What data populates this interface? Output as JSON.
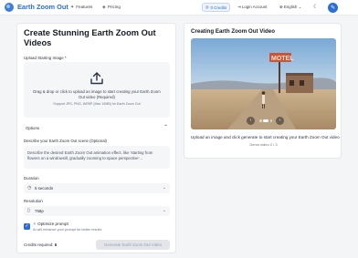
{
  "nav": {
    "brand": "Earth Zoom Out",
    "links": [
      {
        "label": "Features",
        "icon": "sparkle-icon"
      },
      {
        "label": "Pricing",
        "icon": "tag-icon"
      }
    ],
    "credits": "0 Credits",
    "login": "Login Account",
    "language": "English",
    "accent_color": "#2b6fd6"
  },
  "left": {
    "title": "Create Stunning Earth Zoom Out Videos",
    "upload_label": "Upload Starting Image *",
    "drop_text": "Drag & drop or click to upload an image to start creating your Earth Zoom Out video (Required)",
    "drop_sub": "Support JPG, PNG, WEBP (Max 10MB) for Earth Zoom Out",
    "options_label": "Options",
    "description_label": "Describe your Earth Zoom Out scene (Optional)",
    "description_placeholder": "Describe the desired Earth Zoom Out animation effect, like 'starting from flowers on a windowsill, gradually zooming to space perspective'...",
    "duration_label": "Duration",
    "duration_value": "6 seconds",
    "resolution_label": "Resolution",
    "resolution_value": "768p",
    "optimize_title": "Optimize prompt",
    "optimize_sub": "AI will enhance your prompt for better results",
    "optimize_checked": true,
    "credits_required_label": "Credits required:",
    "credits_required_value": "6",
    "generate_label": "Generate Earth Zoom Out Video"
  },
  "right": {
    "title": "Creating Earth Zoom Out Video",
    "text": "Upload an image and click generate to start creating your Earth Zoom Out video",
    "demo_counter": "Demo video 2 / 3",
    "photo_sign": "MOTEL"
  }
}
